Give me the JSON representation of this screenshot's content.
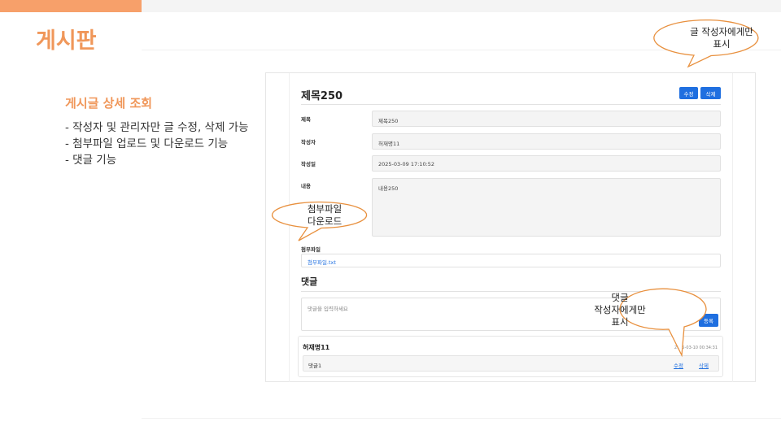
{
  "slide": {
    "title": "게시판",
    "section_title": "게시글 상세 조회",
    "bullets": [
      "- 작성자 및 관리자만 글 수정, 삭제 가능",
      "- 첨부파일 업로드 및 다운로드 기능",
      "- 댓글 기능"
    ],
    "accent_color": "#f0975a"
  },
  "post": {
    "title": "제목250",
    "edit_label": "수정",
    "delete_label": "삭제",
    "fields": {
      "title_label": "제목",
      "title_value": "제목250",
      "author_label": "작성자",
      "author_value": "허재명11",
      "date_label": "작성일",
      "date_value": "2025-03-09 17:10:52",
      "content_label": "내용",
      "content_value": "내용250"
    },
    "attachment_label": "첨부파일",
    "attachment_file": "첨부파일.txt"
  },
  "comments": {
    "heading": "댓글",
    "input_placeholder": "댓글을 입력하세요",
    "register_label": "등록",
    "items": [
      {
        "author": "허재명11",
        "time": "2025-03-10 00:34:31",
        "text": "댓글1",
        "edit_label": "수정",
        "delete_label": "삭제"
      }
    ]
  },
  "callouts": {
    "author_only_line1": "글 작성자에게만",
    "author_only_line2": "표시",
    "download_line1": "첨부파일",
    "download_line2": "다운로드",
    "comment_line1": "댓글",
    "comment_line2": "작성자에게만",
    "comment_line3": "표시"
  },
  "colors": {
    "primary_button": "#1f6fe0",
    "callout_border": "#e8903e"
  }
}
